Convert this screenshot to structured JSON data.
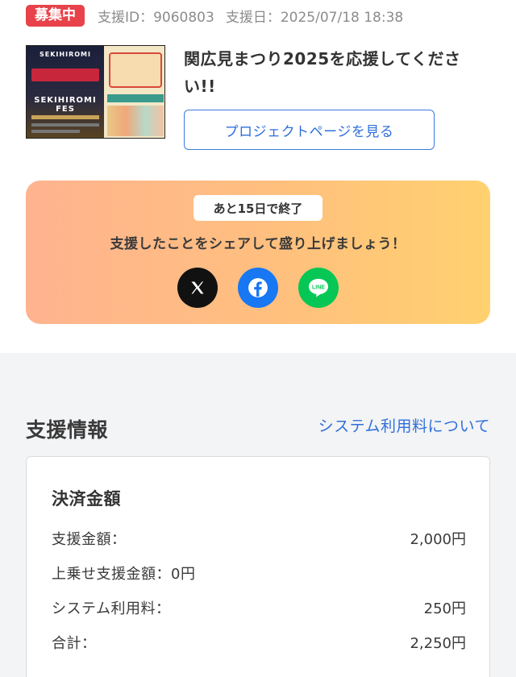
{
  "header": {
    "status_badge": "募集中",
    "support_id": "支援ID：9060803",
    "support_date": "支援日：2025/07/18 18:38"
  },
  "project": {
    "title": "関広見まつり2025を応援してください!!",
    "button_label": "プロジェクトページを見る",
    "thumbnail_text_top": "SEKIHIROMI",
    "thumbnail_text_mid": "SEKIHIROMI FES"
  },
  "share": {
    "deadline": "あと15日で終了",
    "message": "支援したことをシェアして盛り上げましょう！",
    "icons": [
      "x-icon",
      "facebook-icon",
      "line-icon"
    ],
    "line_text": "LINE"
  },
  "support_info": {
    "title": "支援情報",
    "fee_link": "システム利用料について",
    "card_title": "決済金額",
    "rows": [
      {
        "label": "支援金額：",
        "value": "2,000円"
      },
      {
        "label": "上乗せ支援金額：0円",
        "value": ""
      },
      {
        "label": "システム利用料：",
        "value": "250円"
      },
      {
        "label": "合計：",
        "value": "2,250円"
      }
    ]
  },
  "colors": {
    "badge": "#e8424a",
    "link": "#2f6fdc",
    "x": "#111111",
    "facebook": "#1877f2",
    "line": "#06c755",
    "gradient_start": "#ffb38f",
    "gradient_end": "#ffd16f"
  }
}
